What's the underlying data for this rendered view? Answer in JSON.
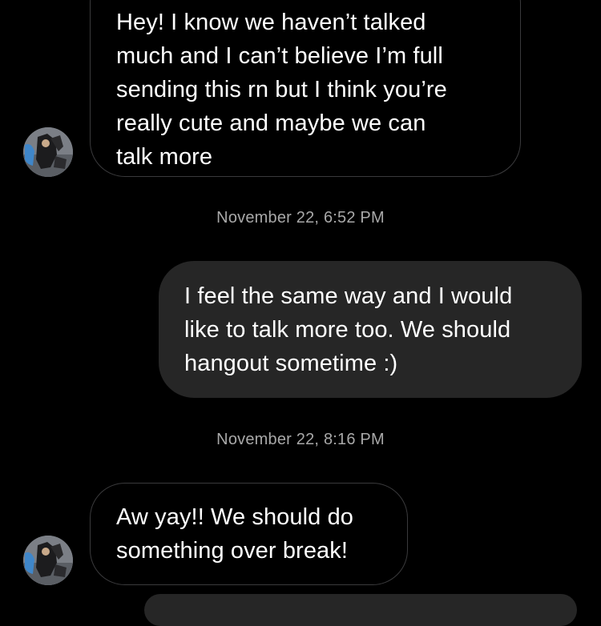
{
  "thread": {
    "messages": [
      {
        "sender": "other",
        "lines": [
          "Hey! I know we haven’t talked",
          "much and I can’t believe I’m full",
          "sending this rn but I think you’re",
          "really cute and maybe we can",
          "talk more"
        ]
      },
      {
        "timestamp": "November 22, 6:52 PM"
      },
      {
        "sender": "me",
        "lines": [
          "I feel the same way and I would",
          "like to talk more too. We should",
          "hangout sometime :)"
        ]
      },
      {
        "timestamp": "November 22, 8:16 PM"
      },
      {
        "sender": "other",
        "lines": [
          "Aw yay!! We should do",
          "something over break!"
        ]
      }
    ]
  },
  "colors": {
    "background": "#000000",
    "incoming_border": "#3a3a3c",
    "outgoing_bubble": "#262626",
    "timestamp_text": "#a8a8a8"
  },
  "icons": {
    "avatar": "contact-avatar-photo"
  }
}
